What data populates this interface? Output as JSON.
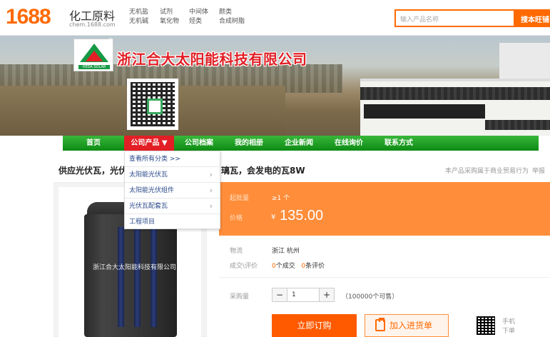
{
  "header": {
    "logo": "1688",
    "site_name": "化工原料",
    "site_domain": "chem.1688.com",
    "categories": [
      [
        "无机盐",
        "无机碱"
      ],
      [
        "试剂",
        "氧化物"
      ],
      [
        "中间体",
        "烃类"
      ],
      [
        "颜类",
        "合成树脂"
      ]
    ],
    "search_placeholder": "输入产品名称",
    "search_button": "搜本旺铺"
  },
  "banner": {
    "company_name": "浙江合大太阳能科技有限公司",
    "logo_text": "HEDA SOLAR",
    "reg_mark": "®"
  },
  "nav": [
    {
      "label": "首页"
    },
    {
      "label": "公司产品 ▼"
    },
    {
      "label": "公司档案"
    },
    {
      "label": "我的相册"
    },
    {
      "label": "企业新闻"
    },
    {
      "label": "在线询价"
    },
    {
      "label": "联系方式"
    }
  ],
  "dropdown": [
    {
      "label": "查看所有分类 >>",
      "arrow": ""
    },
    {
      "label": "太阳能光伏瓦",
      "arrow": "›"
    },
    {
      "label": "太阳能光伏组件",
      "arrow": "›"
    },
    {
      "label": "光伏瓦配套瓦",
      "arrow": "›"
    },
    {
      "label": "工程项目",
      "arrow": ""
    }
  ],
  "product": {
    "title_head": "供应光伏瓦，光伏",
    "title_tail": "璃瓦，会发电的瓦8W",
    "trade_note": "本产品采购属于商业贸易行为",
    "report": "举报",
    "image_watermark": "浙江合大太阳能科技有限公司"
  },
  "pricing": {
    "moq_label": "起批量",
    "moq_value": "≥1 个",
    "price_label": "价格",
    "currency": "¥",
    "price": "135.00"
  },
  "details": {
    "logistics_label": "物流",
    "logistics_value": "浙江 杭州",
    "deals_label": "成交\\评价",
    "deals_count": "0",
    "deals_unit": "个成交",
    "reviews_count": "0",
    "reviews_unit": "条评价",
    "quantity_label": "采购量",
    "quantity_value": "1",
    "minus": "−",
    "plus": "+",
    "available": "（100000个可售）"
  },
  "actions": {
    "buy_now": "立即订购",
    "add_cart": "加入进货单",
    "mobile_order": "手机下单"
  },
  "colors": {
    "brand_orange": "#ff6a00",
    "nav_green": "#0d8a14",
    "nav_active_red": "#e21f25",
    "price_panel": "#ff8d3a"
  }
}
